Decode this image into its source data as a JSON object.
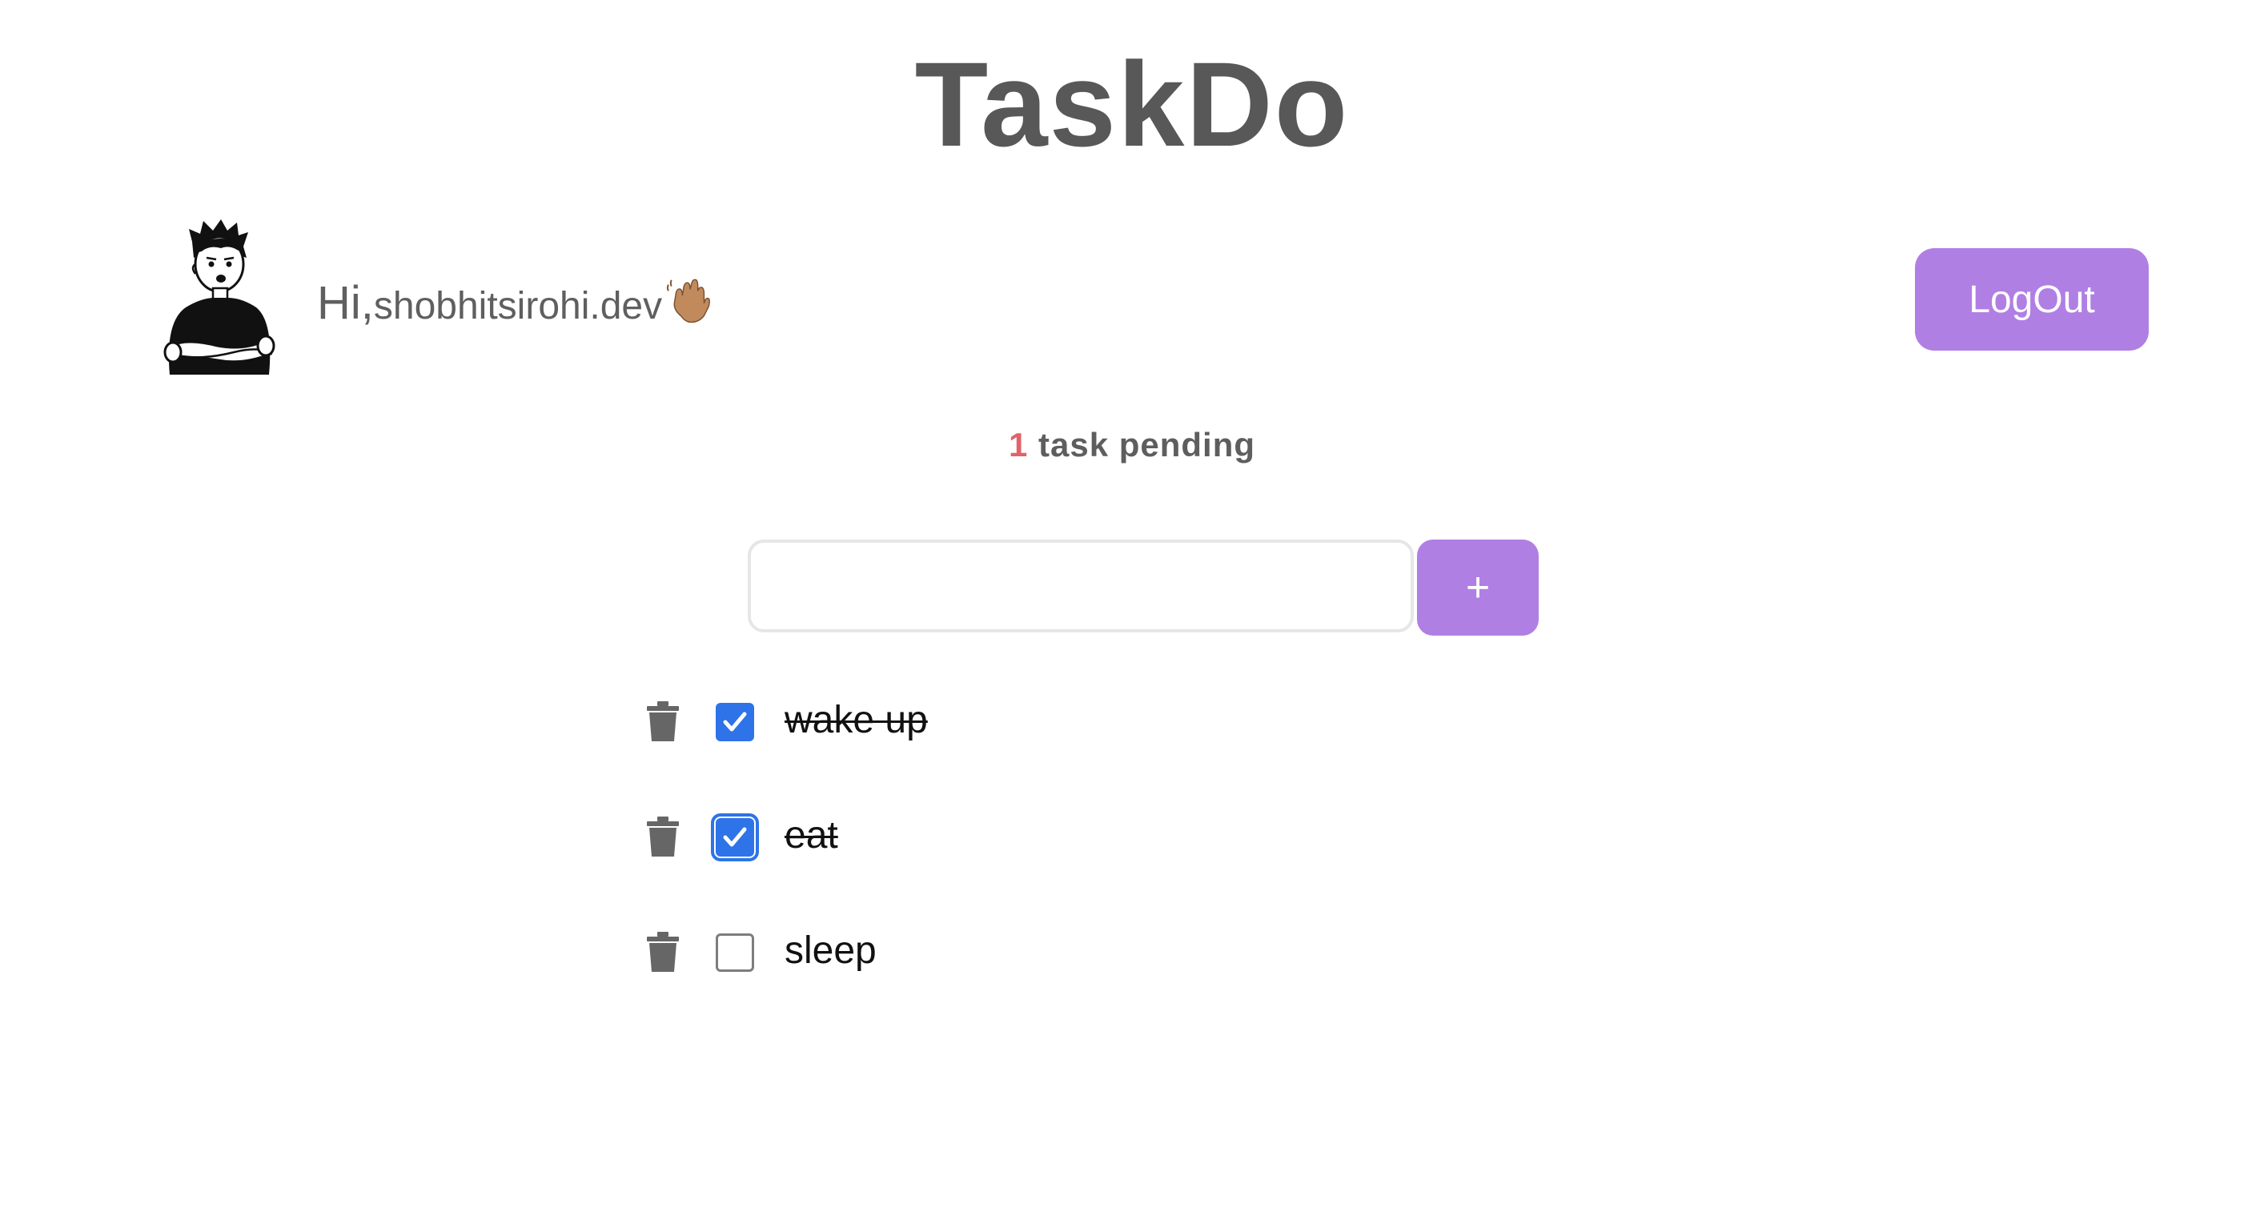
{
  "app": {
    "title": "TaskDo"
  },
  "header": {
    "greeting_hi": "Hi,",
    "username": "shobhitsirohi.dev",
    "logout_label": "LogOut"
  },
  "summary": {
    "pending_count": "1",
    "pending_text": " task pending"
  },
  "new_task": {
    "value": "",
    "placeholder": "",
    "add_label": "+"
  },
  "tasks": [
    {
      "label": "wake up",
      "completed": true
    },
    {
      "label": "eat",
      "completed": true
    },
    {
      "label": "sleep",
      "completed": false
    }
  ],
  "colors": {
    "accent": "#b07fe4",
    "checkbox_checked": "#2e73e8",
    "pending_count": "#e0626b",
    "title": "#585858"
  },
  "icons": {
    "delete": "trash-icon",
    "avatar": "avatar-illustration",
    "wave": "waving-hand-icon"
  }
}
